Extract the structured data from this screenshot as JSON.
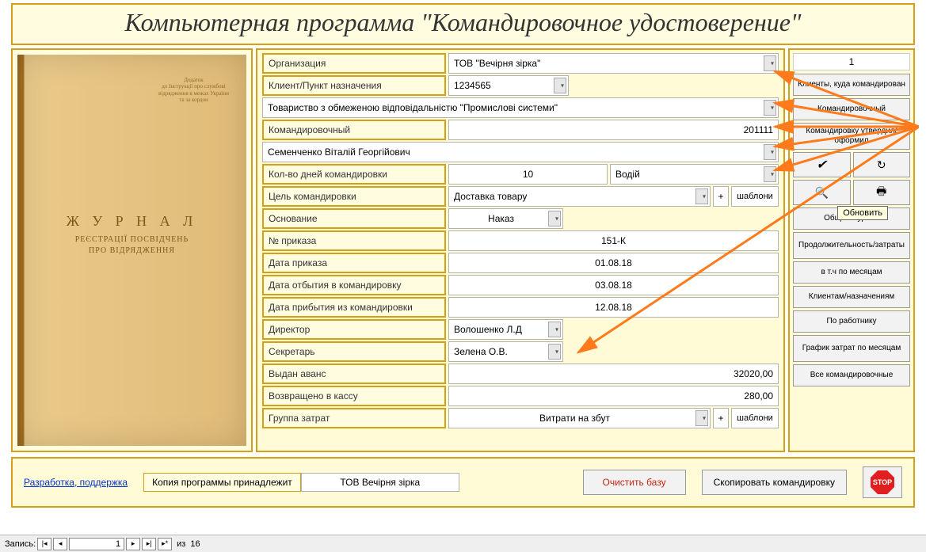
{
  "title": "Компьютерная программа \"Командировочное удостоверение\"",
  "journal": {
    "top_note": "Додаток\nдо Інструкції про службові\nвідрядження в межах України\nта за кордон",
    "main": "Ж У Р Н А Л",
    "sub1": "РЕЄСТРАЦІЇ ПОСВІДЧЕНЬ",
    "sub2": "ПРО ВІДРЯДЖЕННЯ"
  },
  "form": {
    "org_label": "Организация",
    "org_value": "ТОВ \"Вечірня зірка\"",
    "client_label": "Клиент/Пункт назначения",
    "client_code": "1234565",
    "client_full": "Товариство з обмеженою відповідальністю \"Промислові системи\"",
    "trip_label": "Командировочный",
    "trip_num": "201111",
    "employee": "Семенченко Віталій Георгійович",
    "days_label": "Кол-во дней командировки",
    "days": "10",
    "position": "Водій",
    "purpose_label": "Цель командировки",
    "purpose": "Доставка товару",
    "basis_label": "Основание",
    "basis": "Наказ",
    "order_label": "№ приказа",
    "order_num": "151-К",
    "order_date_label": "Дата приказа",
    "order_date": "01.08.18",
    "depart_label": "Дата отбытия в командировку",
    "depart": "03.08.18",
    "arrive_label": "Дата прибытия из командировки",
    "arrive": "12.08.18",
    "director_label": "Директор",
    "director": "Волошенко Л.Д",
    "secretary_label": "Секретарь",
    "secretary": "Зелена О.В.",
    "advance_label": "Выдан аванс",
    "advance": "32020,00",
    "returned_label": "Возвращено в кассу",
    "returned": "280,00",
    "costgroup_label": "Группа затрат",
    "costgroup": "Витрати на збут",
    "plus": "+",
    "templates": "шаблони"
  },
  "right": {
    "record_num": "1",
    "clients": "Клиенты, куда командирован",
    "employees": "Командировочный",
    "approver": "Командировку утвердил/оформил",
    "refresh_tip": "Обновить",
    "report_total": "Общий журнал",
    "report_duration": "Продолжительность/затраты",
    "report_months": "в т.ч по месяцам",
    "report_clients": "Клиентам/назначениям",
    "report_employee": "По работнику",
    "report_graph": "График затрат по месяцам",
    "report_all": "Все командировочные"
  },
  "bottom": {
    "dev_link": "Разработка, поддержка",
    "copy_label": "Копия программы принадлежит",
    "copy_owner": "ТОВ Вечірня зірка",
    "clear_db": "Очистить базу",
    "copy_trip": "Скопировать командировку",
    "stop": "STOP"
  },
  "nav": {
    "label": "Запись:",
    "current": "1",
    "of": "из",
    "total": "16"
  }
}
